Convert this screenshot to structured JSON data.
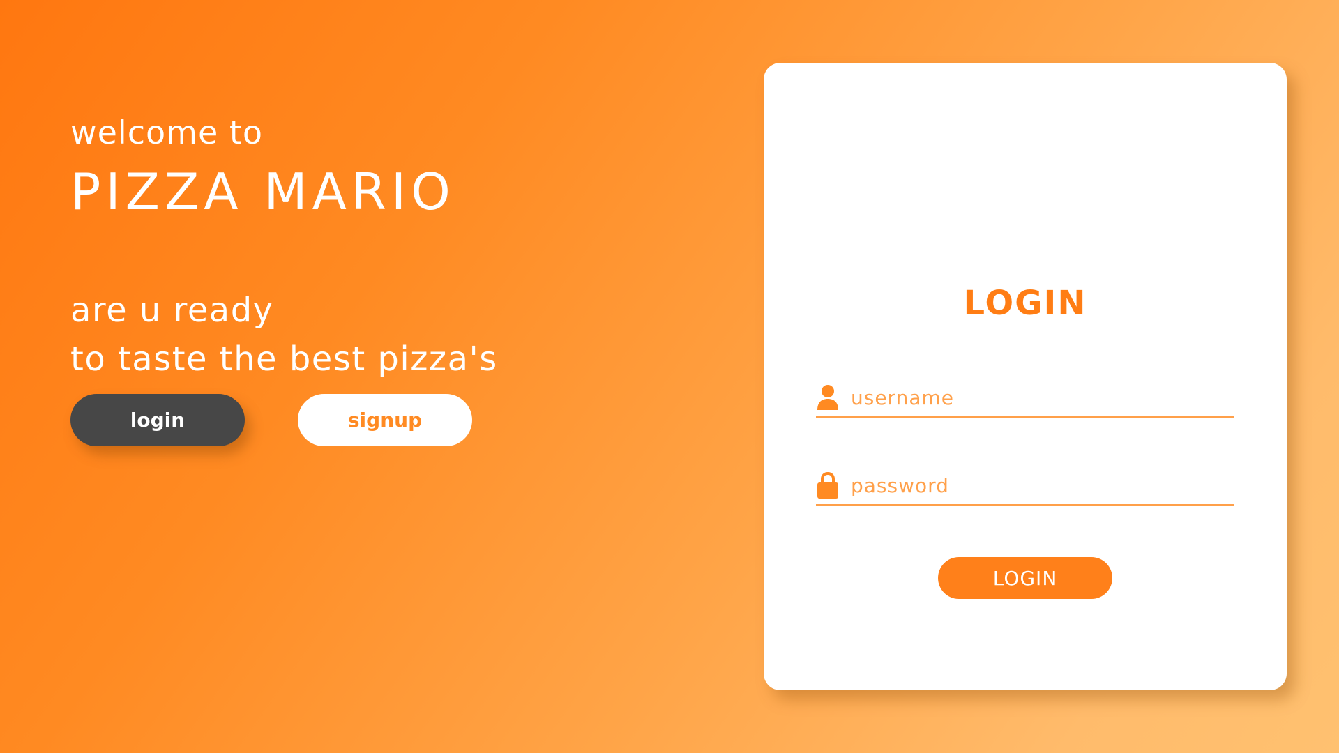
{
  "hero": {
    "welcome": "welcome to",
    "brand": "PIZZA MARIO",
    "tagline_line1": "are u ready",
    "tagline_line2": "to taste the best pizza's",
    "login_label": "login",
    "signup_label": "signup"
  },
  "login_card": {
    "title": "LOGIN",
    "username_placeholder": "username",
    "password_placeholder": "password",
    "submit_label": "LOGIN",
    "username_icon": "user-icon",
    "password_icon": "lock-icon"
  },
  "colors": {
    "accent": "#ff801a",
    "dark_button": "#474747",
    "background_start": "#ff7710",
    "background_end": "#ffc170"
  }
}
